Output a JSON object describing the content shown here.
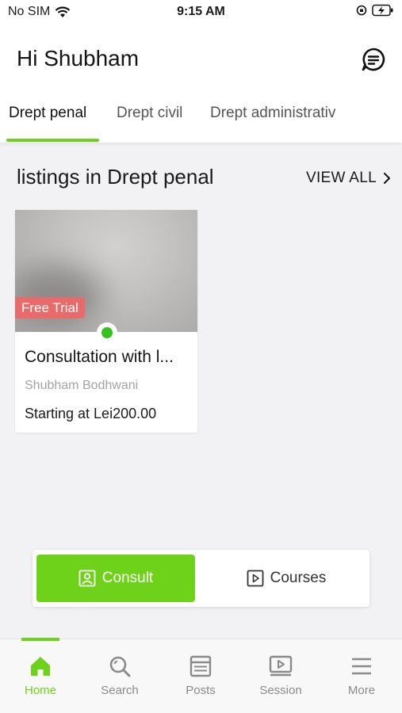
{
  "status_bar": {
    "carrier": "No SIM",
    "time": "9:15 AM"
  },
  "header": {
    "greeting": "Hi Shubham"
  },
  "categories": [
    {
      "label": "Drept penal",
      "active": true
    },
    {
      "label": "Drept civil",
      "active": false
    },
    {
      "label": "Drept administrativ",
      "active": false
    }
  ],
  "section": {
    "title": "listings in Drept penal",
    "view_all": "VIEW ALL"
  },
  "listing": {
    "badge": "Free Trial",
    "title": "Consultation with l...",
    "author": "Shubham Bodhwani",
    "price": "Starting at Lei200.00"
  },
  "toggle": {
    "consult": "Consult",
    "courses": "Courses"
  },
  "tab_bar": [
    {
      "label": "Home",
      "icon": "home-icon",
      "active": true
    },
    {
      "label": "Search",
      "icon": "search-icon",
      "active": false
    },
    {
      "label": "Posts",
      "icon": "posts-icon",
      "active": false
    },
    {
      "label": "Session",
      "icon": "session-icon",
      "active": false
    },
    {
      "label": "More",
      "icon": "menu-icon",
      "active": false
    }
  ],
  "colors": {
    "accent": "#6fd21a",
    "badge": "#e96a6a",
    "online": "#35c21f"
  }
}
